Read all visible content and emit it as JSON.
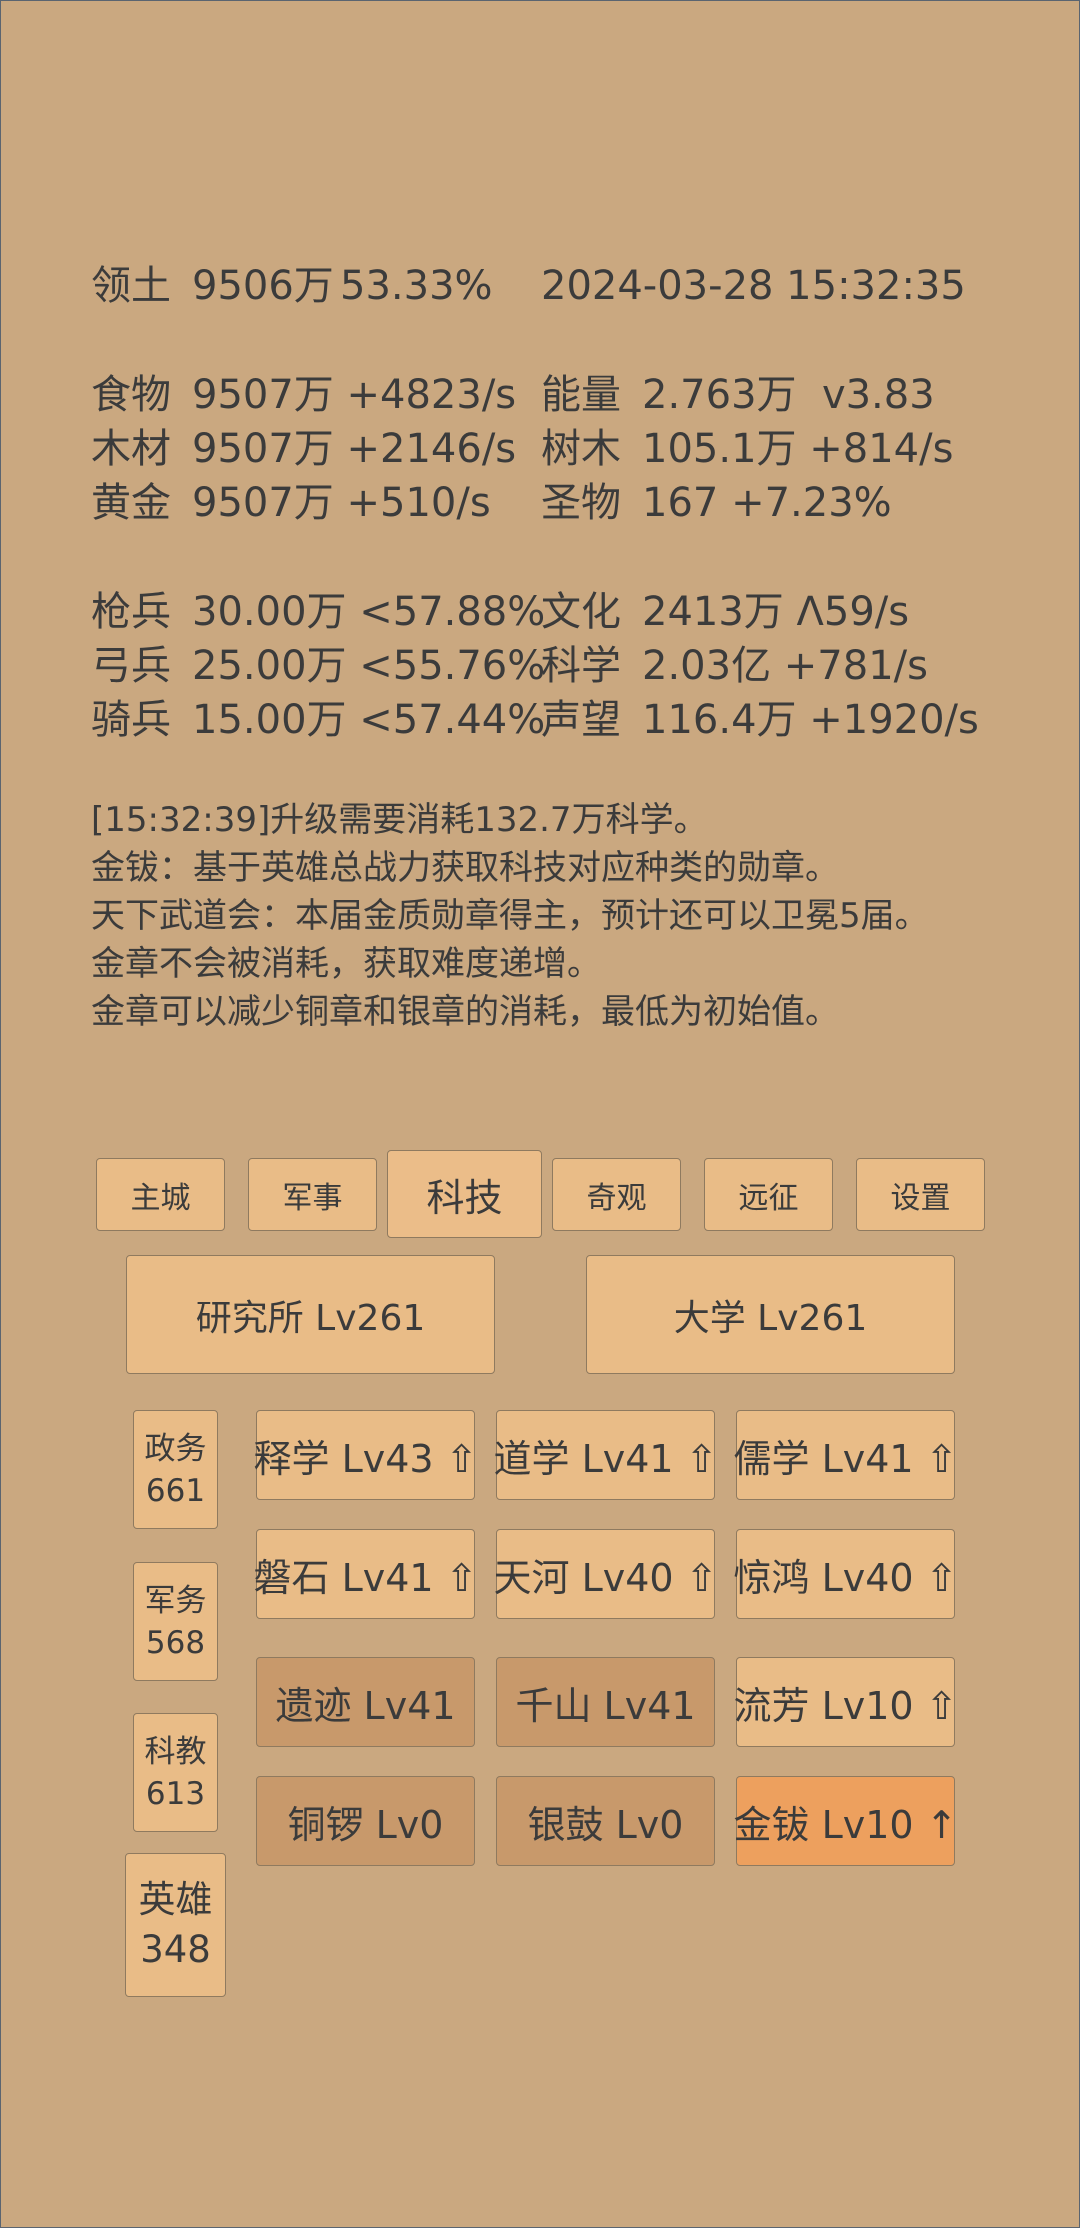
{
  "header": {
    "territory_label": "领土",
    "territory_value": "9506万",
    "territory_pct": "53.33%",
    "datetime": "2024-03-28 15:32:35"
  },
  "resources": {
    "food": {
      "label": "食物",
      "value": "9507万 +4823/s"
    },
    "wood": {
      "label": "木材",
      "value": "9507万 +2146/s"
    },
    "gold": {
      "label": "黄金",
      "value": "9507万 +510/s"
    },
    "energy": {
      "label": "能量",
      "value": "2.763万  v3.83"
    },
    "trees": {
      "label": "树木",
      "value": "105.1万 +814/s"
    },
    "relics": {
      "label": "圣物",
      "value": "167 +7.23%"
    }
  },
  "army": {
    "spear": {
      "label": "枪兵",
      "value": "30.00万 <57.88%"
    },
    "archer": {
      "label": "弓兵",
      "value": "25.00万 <55.76%"
    },
    "cavalry": {
      "label": "骑兵",
      "value": "15.00万 <57.44%"
    },
    "culture": {
      "label": "文化",
      "value": "2413万 Λ59/s"
    },
    "science": {
      "label": "科学",
      "value": "2.03亿 +781/s"
    },
    "prestige": {
      "label": "声望",
      "value": "116.4万 +1920/s"
    }
  },
  "log": [
    "[15:32:39]升级需要消耗132.7万科学。",
    "金钹：基于英雄总战力获取科技对应种类的勋章。",
    "天下武道会：本届金质勋章得主，预计还可以卫冕5届。",
    "金章不会被消耗，获取难度递增。",
    "金章可以减少铜章和银章的消耗，最低为初始值。"
  ],
  "tabs": [
    "主城",
    "军事",
    "科技",
    "奇观",
    "远征",
    "设置"
  ],
  "active_tab": "科技",
  "buildings": {
    "institute": "研究所 Lv261",
    "university": "大学 Lv261"
  },
  "side": {
    "politics": {
      "label": "政务",
      "value": "661"
    },
    "military": {
      "label": "军务",
      "value": "568"
    },
    "education": {
      "label": "科教",
      "value": "613"
    },
    "heroes": {
      "label": "英雄",
      "value": "348"
    }
  },
  "techs": [
    "释学 Lv43 ⇧",
    "道学 Lv41 ⇧",
    "儒学 Lv41 ⇧",
    "磐石 Lv41 ⇧",
    "天河 Lv40 ⇧",
    "惊鸿 Lv40 ⇧",
    "遗迹 Lv41",
    "千山 Lv41",
    "流芳 Lv10 ⇧",
    "铜锣 Lv0",
    "银鼓 Lv0",
    "金钹 Lv10 ↑"
  ],
  "colors": {
    "background": "#caa880",
    "button": "#e9bc87",
    "button_disabled": "#c8996b",
    "button_highlight": "#eda05e",
    "text": "#3b3b3b"
  }
}
